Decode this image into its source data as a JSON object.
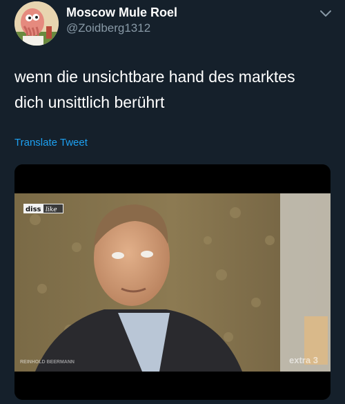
{
  "tweet": {
    "display_name": "Moscow Mule Roel",
    "handle": "@Zoidberg1312",
    "text_line1": "wenn die unsichtbare hand des marktes",
    "text_line2": "dich unsittlich berührt",
    "translate_label": "Translate Tweet",
    "menu_icon": "chevron-down-icon"
  },
  "media": {
    "logo_diss": "diss",
    "logo_like": "like",
    "watermark_right": "extra 3",
    "watermark_left": "REINHOLD BEERMANN"
  },
  "colors": {
    "background": "#15202b",
    "text": "#ffffff",
    "secondary": "#8899a6",
    "accent": "#1da1f2"
  }
}
